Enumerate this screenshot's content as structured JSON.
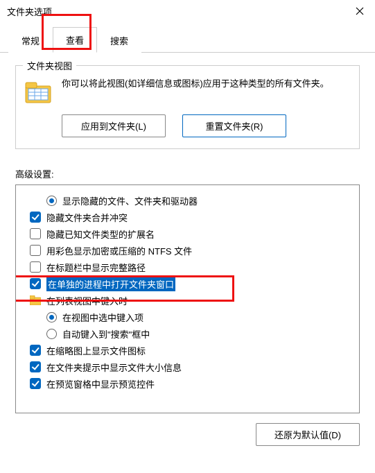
{
  "title": "文件夹选项",
  "tabs": {
    "general": "常规",
    "view": "查看",
    "search": "搜索"
  },
  "folderViews": {
    "group_title": "文件夹视图",
    "description": "你可以将此视图(如详细信息或图标)应用于这种类型的所有文件夹。",
    "apply_btn": "应用到文件夹(L)",
    "reset_btn": "重置文件夹(R)"
  },
  "advanced_label": "高级设置:",
  "items": {
    "show_hidden": "显示隐藏的文件、文件夹和驱动器",
    "hide_merge_conflict": "隐藏文件夹合并冲突",
    "hide_known_ext": "隐藏已知文件类型的扩展名",
    "color_ntfs": "用彩色显示加密或压缩的 NTFS 文件",
    "title_full_path": "在标题栏中显示完整路径",
    "separate_process": "在单独的进程中打开文件夹窗口",
    "list_type_ahead": "在列表视图中键入时",
    "select_typed": "在视图中选中键入项",
    "auto_search": "自动键入到\"搜索\"框中",
    "thumb_icons": "在缩略图上显示文件图标",
    "tip_size": "在文件夹提示中显示文件大小信息",
    "preview_handlers": "在预览窗格中显示预览控件"
  },
  "restore_btn": "还原为默认值(D)"
}
